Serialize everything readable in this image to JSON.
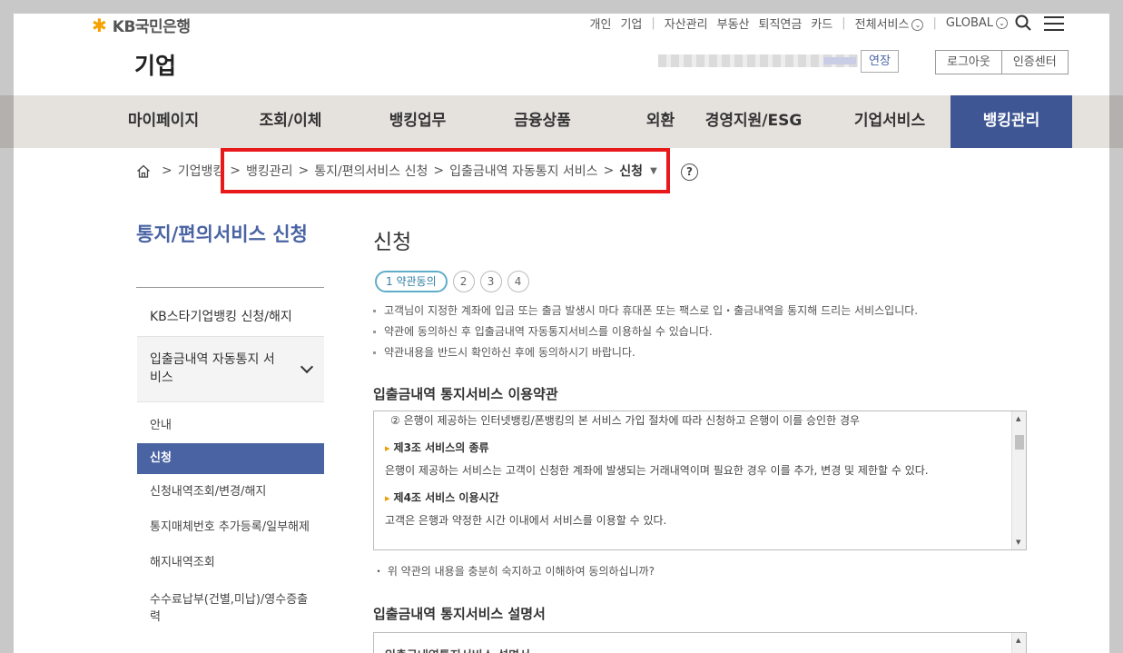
{
  "header": {
    "logo_text": "KB국민은행",
    "logo_star": "✱",
    "util_links": [
      "개인",
      "기업",
      "자산관리",
      "부동산",
      "퇴직연금",
      "카드"
    ],
    "all_services": "전체서비스",
    "global": "GLOBAL",
    "corp_title": "기업",
    "extend_label": "연장",
    "logout_label": "로그아웃",
    "cert_center_label": "인증센터"
  },
  "gnb": {
    "items": [
      "마이페이지",
      "조회/이체",
      "뱅킹업무",
      "금융상품",
      "외환",
      "경영지원/ESG",
      "기업서비스",
      "뱅킹관리"
    ],
    "active": "뱅킹관리"
  },
  "breadcrumb": {
    "items": [
      "기업뱅킹",
      "뱅킹관리",
      "통지/편의서비스 신청",
      "입출금내역 자동통지 서비스"
    ],
    "current": "신청",
    "help": "?"
  },
  "side": {
    "title": "통지/편의서비스 신청",
    "item1": "KB스타기업뱅킹 신청/해지",
    "open_item": "입출금내역 자동통지 서비스",
    "subs": [
      "안내",
      "신청",
      "신청내역조회/변경/해지",
      "통지매체번호 추가등록/일부해제",
      "해지내역조회",
      "수수료납부(건별,미납)/영수증출력"
    ]
  },
  "main": {
    "title": "신청",
    "steps": [
      "1 약관동의",
      "2",
      "3",
      "4"
    ],
    "notes": [
      "고객님이 지정한 계좌에 입금 또는 출금 발생시 마다 휴대폰 또는 팩스로 입・출금내역을 통지해 드리는 서비스입니다.",
      "약관에 동의하신 후 입출금내역 자동통지서비스를 이용하실 수 있습니다.",
      "약관내용을 반드시 확인하신 후에 동의하시기 바랍니다."
    ],
    "terms_title": "입출금내역 통지서비스 이용약관",
    "terms": {
      "line1": "② 은행이 제공하는 인터넷뱅킹/폰뱅킹의 본 서비스 가입 절차에 따라 신청하고 은행이 이를 승인한 경우",
      "art3_title": "제3조 서비스의 종류",
      "art3_body": "은행이 제공하는 서비스는 고객이 신청한 계좌에 발생되는 거래내역이며 필요한 경우 이를 추가, 변경 및 제한할 수 있다.",
      "art4_title": "제4조 서비스 이용시간",
      "art4_body": "고객은 은행과 약정한 시간 이내에서 서비스를 이용할 수 있다."
    },
    "agree_question": "위 약관의 내용을 충분히 숙지하고 이해하여 동의하십니까?",
    "desc_title": "입출금내역 통지서비스 설명서",
    "desc_box_title": "입출금내역통지서비스 설명서"
  }
}
